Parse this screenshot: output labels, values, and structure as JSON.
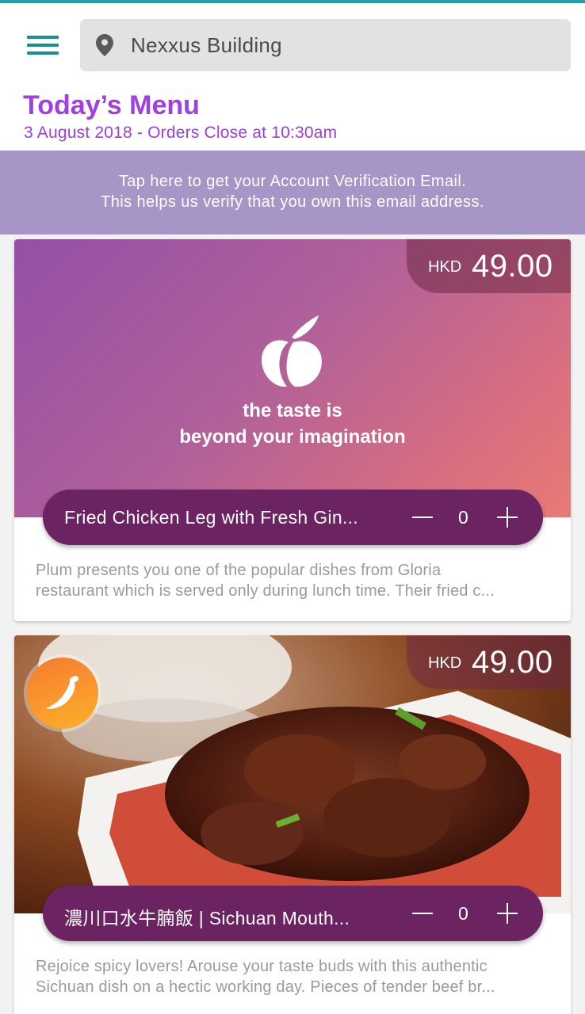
{
  "header": {
    "location": "Nexxus Building",
    "title": "Today’s Menu",
    "subtitle": "3 August 2018 - Orders Close at 10:30am"
  },
  "verify_banner": {
    "line1": "Tap here to get your Account Verification Email.",
    "line2": "This helps us verify that you own this email address."
  },
  "dishes": [
    {
      "currency": "HKD",
      "price": "49.00",
      "image_tagline_1": "the taste is",
      "image_tagline_2": "beyond your imagination",
      "name": "Fried Chicken Leg with Fresh Gin...",
      "quantity": "0",
      "description_1": "Plum presents you one of the popular dishes from Gloria",
      "description_2": "restaurant which is served only during lunch time. Their fried c..."
    },
    {
      "currency": "HKD",
      "price": "49.00",
      "badge_icon": "chili-pepper-icon",
      "name": "濃川口水牛腩飯 | Sichuan Mouth...",
      "quantity": "0",
      "description_1": "Rejoice spicy lovers! Arouse your taste buds with this authentic",
      "description_2": "Sichuan dish on a hectic working day. Pieces of tender beef br..."
    }
  ],
  "colors": {
    "accent_teal": "#1a8f94",
    "title_purple": "#a23fe0",
    "banner_lavender": "#a695c6",
    "pill_plum": "#6b2461"
  }
}
